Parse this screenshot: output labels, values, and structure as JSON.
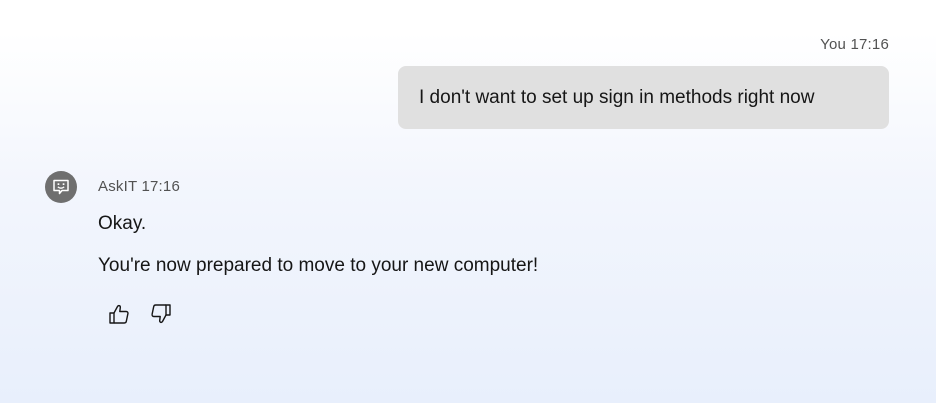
{
  "user_message": {
    "sender": "You",
    "time": "17:16",
    "text": "I don't want to set up sign in methods right now"
  },
  "bot_message": {
    "sender": "AskIT",
    "time": "17:16",
    "avatar_icon": "chat-bot-icon",
    "lines": [
      "Okay.",
      "You're now prepared to move to your new computer!"
    ]
  },
  "feedback": {
    "thumbs_up_icon": "thumbs-up-icon",
    "thumbs_down_icon": "thumbs-down-icon"
  },
  "colors": {
    "bubble": "#e0e0e0",
    "avatar": "#6f6f6f",
    "text": "#161616",
    "meta": "#525252"
  }
}
